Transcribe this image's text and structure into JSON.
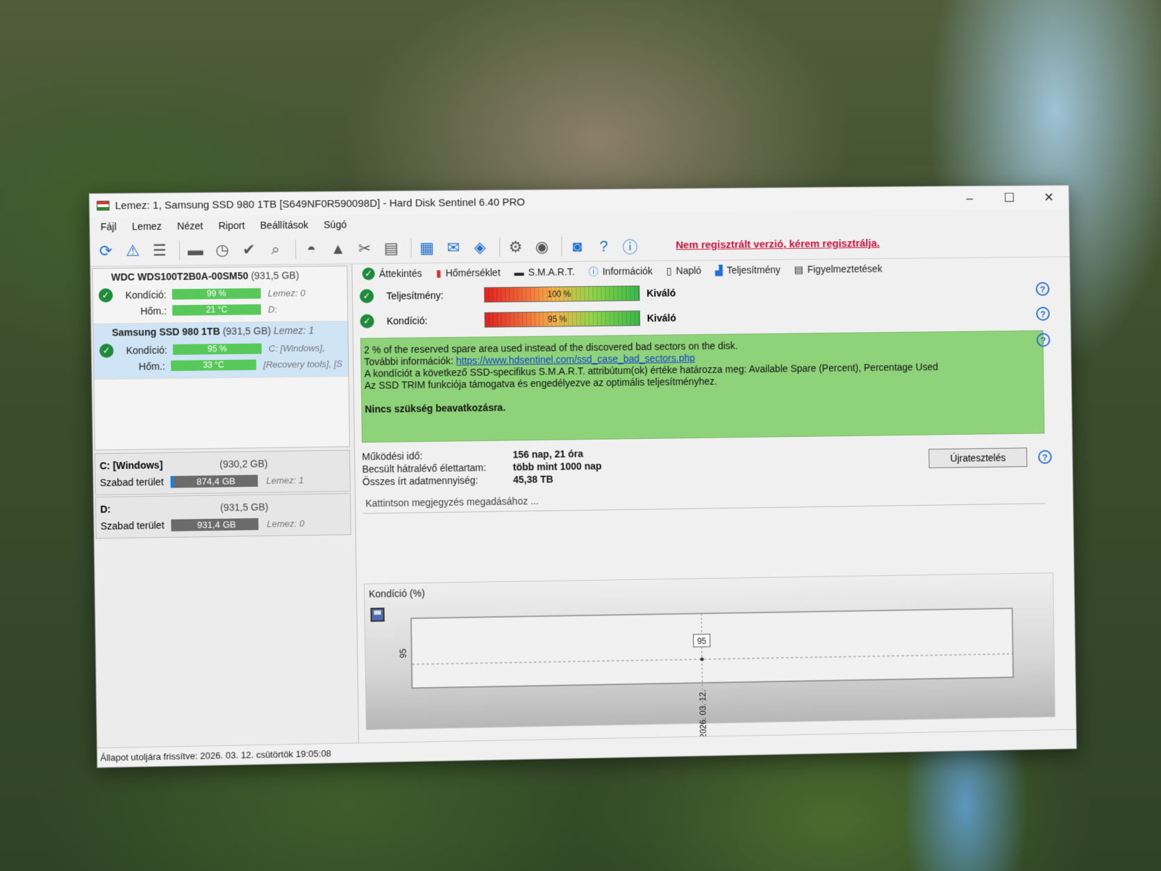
{
  "window": {
    "title": "Lemez: 1, Samsung SSD 980 1TB [S649NF0R590098D]  -  Hard Disk Sentinel 6.40 PRO",
    "controls": {
      "minimize": "–",
      "maximize": "☐",
      "close": "✕"
    }
  },
  "menu": [
    "Fájl",
    "Lemez",
    "Nézet",
    "Riport",
    "Beállítások",
    "Súgó"
  ],
  "toolbar": {
    "register_notice": "Nem regisztrált verzió, kérem regisztrálja."
  },
  "disks": [
    {
      "name": "WDC  WDS100T2B0A-00SM50",
      "size": "(931,5 GB)",
      "disk_label": "",
      "condition_label": "Kondíció:",
      "condition_value": "99 %",
      "temp_label": "Hőm.:",
      "temp_value": "21 °C",
      "side1": "Lemez: 0",
      "side2": "D:"
    },
    {
      "name": "Samsung SSD 980 1TB",
      "size": "(931,5 GB)",
      "disk_label": "Lemez: 1",
      "condition_label": "Kondíció:",
      "condition_value": "95 %",
      "temp_label": "Hőm.:",
      "temp_value": "33 °C",
      "side1": "C: [Windows],",
      "side2": "[Recovery tools],  [S"
    }
  ],
  "volumes": [
    {
      "name": "C: [Windows]",
      "size": "(930,2 GB)",
      "free_label": "Szabad terület",
      "free_value": "874,4 GB",
      "disk": "Lemez: 1"
    },
    {
      "name": "D:",
      "size": "(931,5 GB)",
      "free_label": "Szabad terület",
      "free_value": "931,4 GB",
      "disk": "Lemez: 0"
    }
  ],
  "tabs": [
    "Áttekintés",
    "Hőmérséklet",
    "S.M.A.R.T.",
    "Információk",
    "Napló",
    "Teljesítmény",
    "Figyelmeztetések"
  ],
  "overview": {
    "performance": {
      "label": "Teljesítmény:",
      "value": "100 %",
      "rating": "Kiváló",
      "percent": 100
    },
    "condition": {
      "label": "Kondíció:",
      "value": "95 %",
      "rating": "Kiváló",
      "percent": 95
    },
    "message_lines": [
      "2 % of the reserved spare area used instead of the discovered bad sectors on the disk.",
      "További információk: ",
      "A kondíciót a következő SSD-specifikus S.M.A.R.T. attribútum(ok) értéke határozza meg:  Available Spare (Percent), Percentage Used",
      "Az SSD TRIM funkciója támogatva és engedélyezve az optimális teljesítményhez."
    ],
    "link": "https://www.hdsentinel.com/ssd_case_bad_sectors.php",
    "conclusion": "Nincs szükség beavatkozásra.",
    "uptime_label": "Működési idő:",
    "uptime_value": "156 nap, 21 óra",
    "lifetime_label": "Becsült hátralévő élettartam:",
    "lifetime_value": "több mint 1000 nap",
    "written_label": "Összes írt adatmennyiség:",
    "written_value": "45,38 TB",
    "restart_button": "Újratesztelés",
    "note_placeholder": "Kattintson megjegyzés megadásához ..."
  },
  "chart_data": {
    "type": "line",
    "title": "Kondíció  (%)",
    "x": [
      "2026. 03. 12."
    ],
    "series": [
      {
        "values": [
          95
        ]
      }
    ],
    "ylabel_tick": "95",
    "point_label": "95"
  },
  "status": "Állapot utoljára frissítve: 2026. 03. 12. csütörtök 19:05:08",
  "help_symbol": "?"
}
